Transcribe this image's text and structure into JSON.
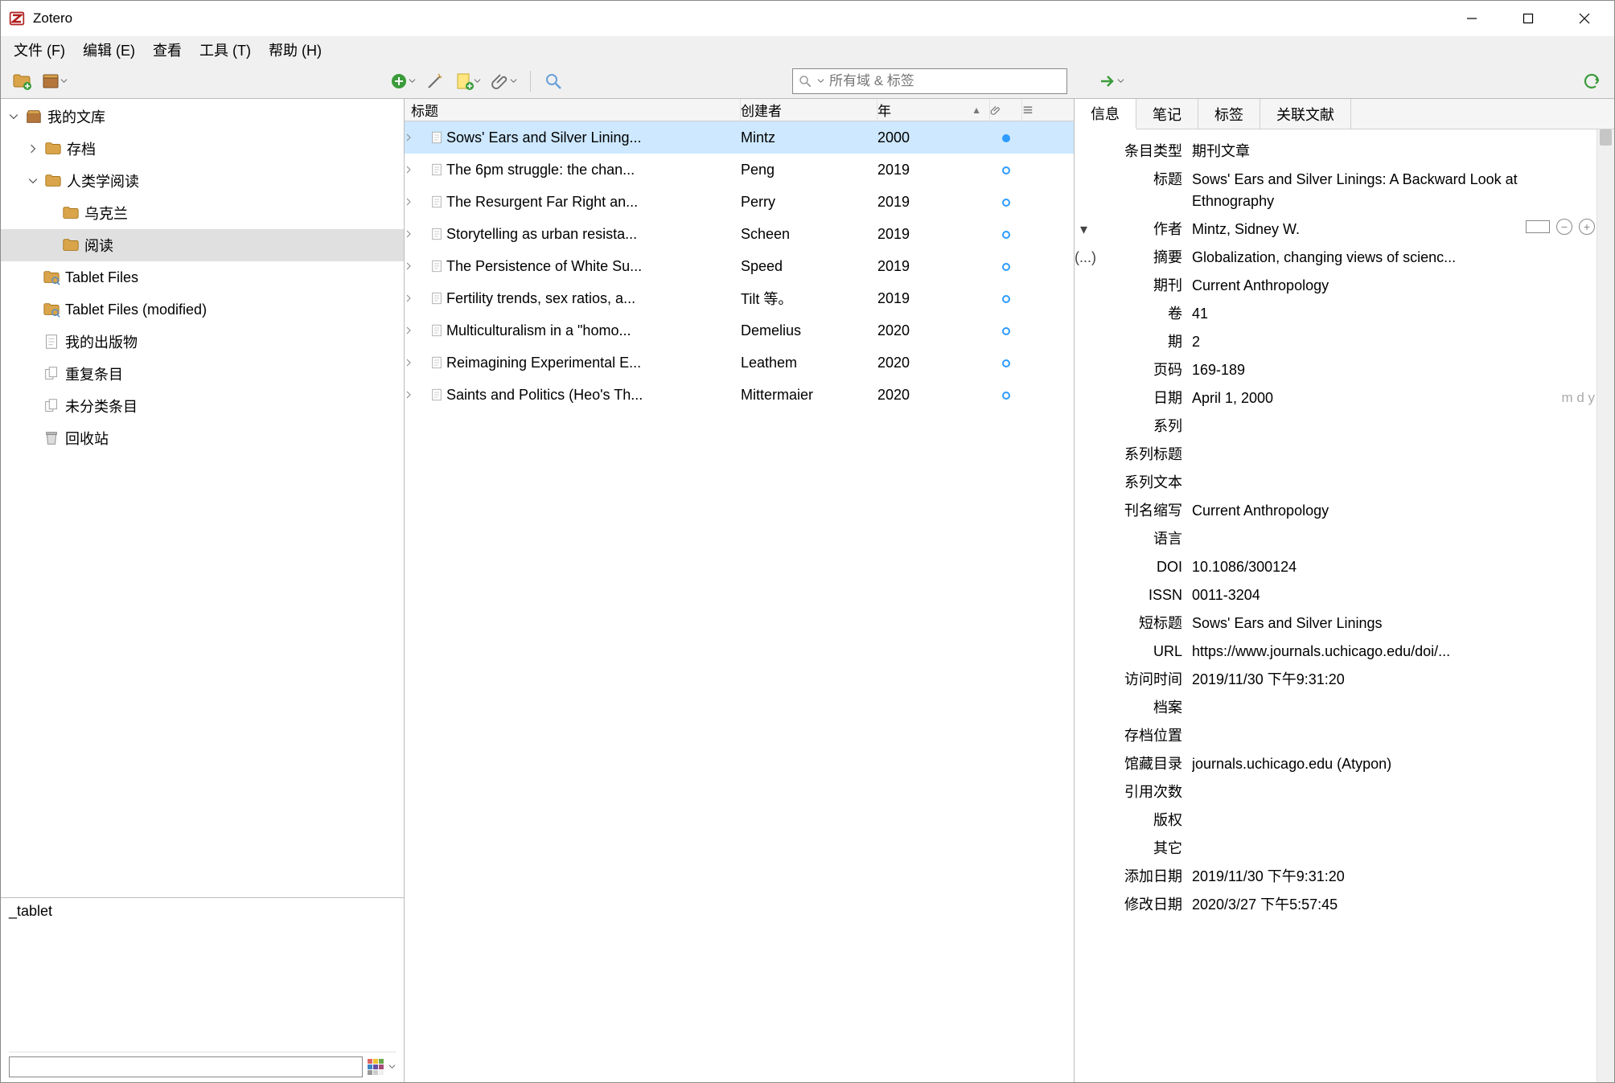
{
  "app": {
    "title": "Zotero"
  },
  "menu": {
    "file": "文件 (F)",
    "edit": "编辑 (E)",
    "view": "查看",
    "tools": "工具 (T)",
    "help": "帮助 (H)"
  },
  "toolbar": {
    "search_placeholder": "所有域 & 标签"
  },
  "tree": {
    "my_library": "我的文库",
    "archive": "存档",
    "anthro_reading": "人类学阅读",
    "ukraine": "乌克兰",
    "reading": "阅读",
    "tablet_files": "Tablet Files",
    "tablet_files_mod": "Tablet Files (modified)",
    "my_pubs": "我的出版物",
    "duplicates": "重复条目",
    "unfiled": "未分类条目",
    "trash": "回收站"
  },
  "tagpane": {
    "tag1": "_tablet"
  },
  "list": {
    "headers": {
      "title": "标题",
      "creator": "创建者",
      "year": "年"
    },
    "rows": [
      {
        "title": "Sows' Ears and Silver Lining...",
        "creator": "Mintz",
        "year": "2000",
        "attach": "full",
        "selected": true
      },
      {
        "title": "The 6pm struggle: the chan...",
        "creator": "Peng",
        "year": "2019",
        "attach": "hollow"
      },
      {
        "title": "The Resurgent Far Right an...",
        "creator": "Perry",
        "year": "2019",
        "attach": "hollow"
      },
      {
        "title": "Storytelling as urban resista...",
        "creator": "Scheen",
        "year": "2019",
        "attach": "hollow"
      },
      {
        "title": "The Persistence of White Su...",
        "creator": "Speed",
        "year": "2019",
        "attach": "hollow"
      },
      {
        "title": "Fertility trends, sex ratios, a...",
        "creator": "Tilt 等。",
        "year": "2019",
        "attach": "hollow"
      },
      {
        "title": "Multiculturalism in a \"homo...",
        "creator": "Demelius",
        "year": "2020",
        "attach": "hollow"
      },
      {
        "title": "Reimagining Experimental E...",
        "creator": "Leathem",
        "year": "2020",
        "attach": "hollow"
      },
      {
        "title": "Saints and Politics (Heo's Th...",
        "creator": "Mittermaier",
        "year": "2020",
        "attach": "hollow"
      }
    ]
  },
  "details": {
    "tabs": {
      "info": "信息",
      "notes": "笔记",
      "tags": "标签",
      "related": "关联文献"
    },
    "fields": {
      "itemType_lbl": "条目类型",
      "itemType": "期刊文章",
      "title_lbl": "标题",
      "title": "Sows' Ears and Silver Linings: A Backward Look at Ethnography",
      "author_lbl": "作者",
      "author": "Mintz, Sidney W.",
      "abstract_pre": "(...)",
      "abstract_lbl": "摘要",
      "abstract": "Globalization, changing views of scienc...",
      "publication_lbl": "期刊",
      "publication": "Current Anthropology",
      "volume_lbl": "卷",
      "volume": "41",
      "issue_lbl": "期",
      "issue": "2",
      "pages_lbl": "页码",
      "pages": "169-189",
      "date_lbl": "日期",
      "date": "April 1, 2000",
      "date_suffix": "m d y",
      "series_lbl": "系列",
      "seriesTitle_lbl": "系列标题",
      "seriesText_lbl": "系列文本",
      "journalAbbr_lbl": "刊名缩写",
      "journalAbbr": "Current Anthropology",
      "language_lbl": "语言",
      "doi_lbl": "DOI",
      "doi": "10.1086/300124",
      "issn_lbl": "ISSN",
      "issn": "0011-3204",
      "shortTitle_lbl": "短标题",
      "shortTitle": "Sows' Ears and Silver Linings",
      "url_lbl": "URL",
      "url": "https://www.journals.uchicago.edu/doi/...",
      "accessed_lbl": "访问时间",
      "accessed": "2019/11/30 下午9:31:20",
      "archive_lbl": "档案",
      "loc_lbl": "存档位置",
      "catalog_lbl": "馆藏目录",
      "catalog": "journals.uchicago.edu (Atypon)",
      "citations_lbl": "引用次数",
      "rights_lbl": "版权",
      "extra_lbl": "其它",
      "added_lbl": "添加日期",
      "added": "2019/11/30 下午9:31:20",
      "modified_lbl": "修改日期",
      "modified": "2020/3/27 下午5:57:45"
    }
  }
}
